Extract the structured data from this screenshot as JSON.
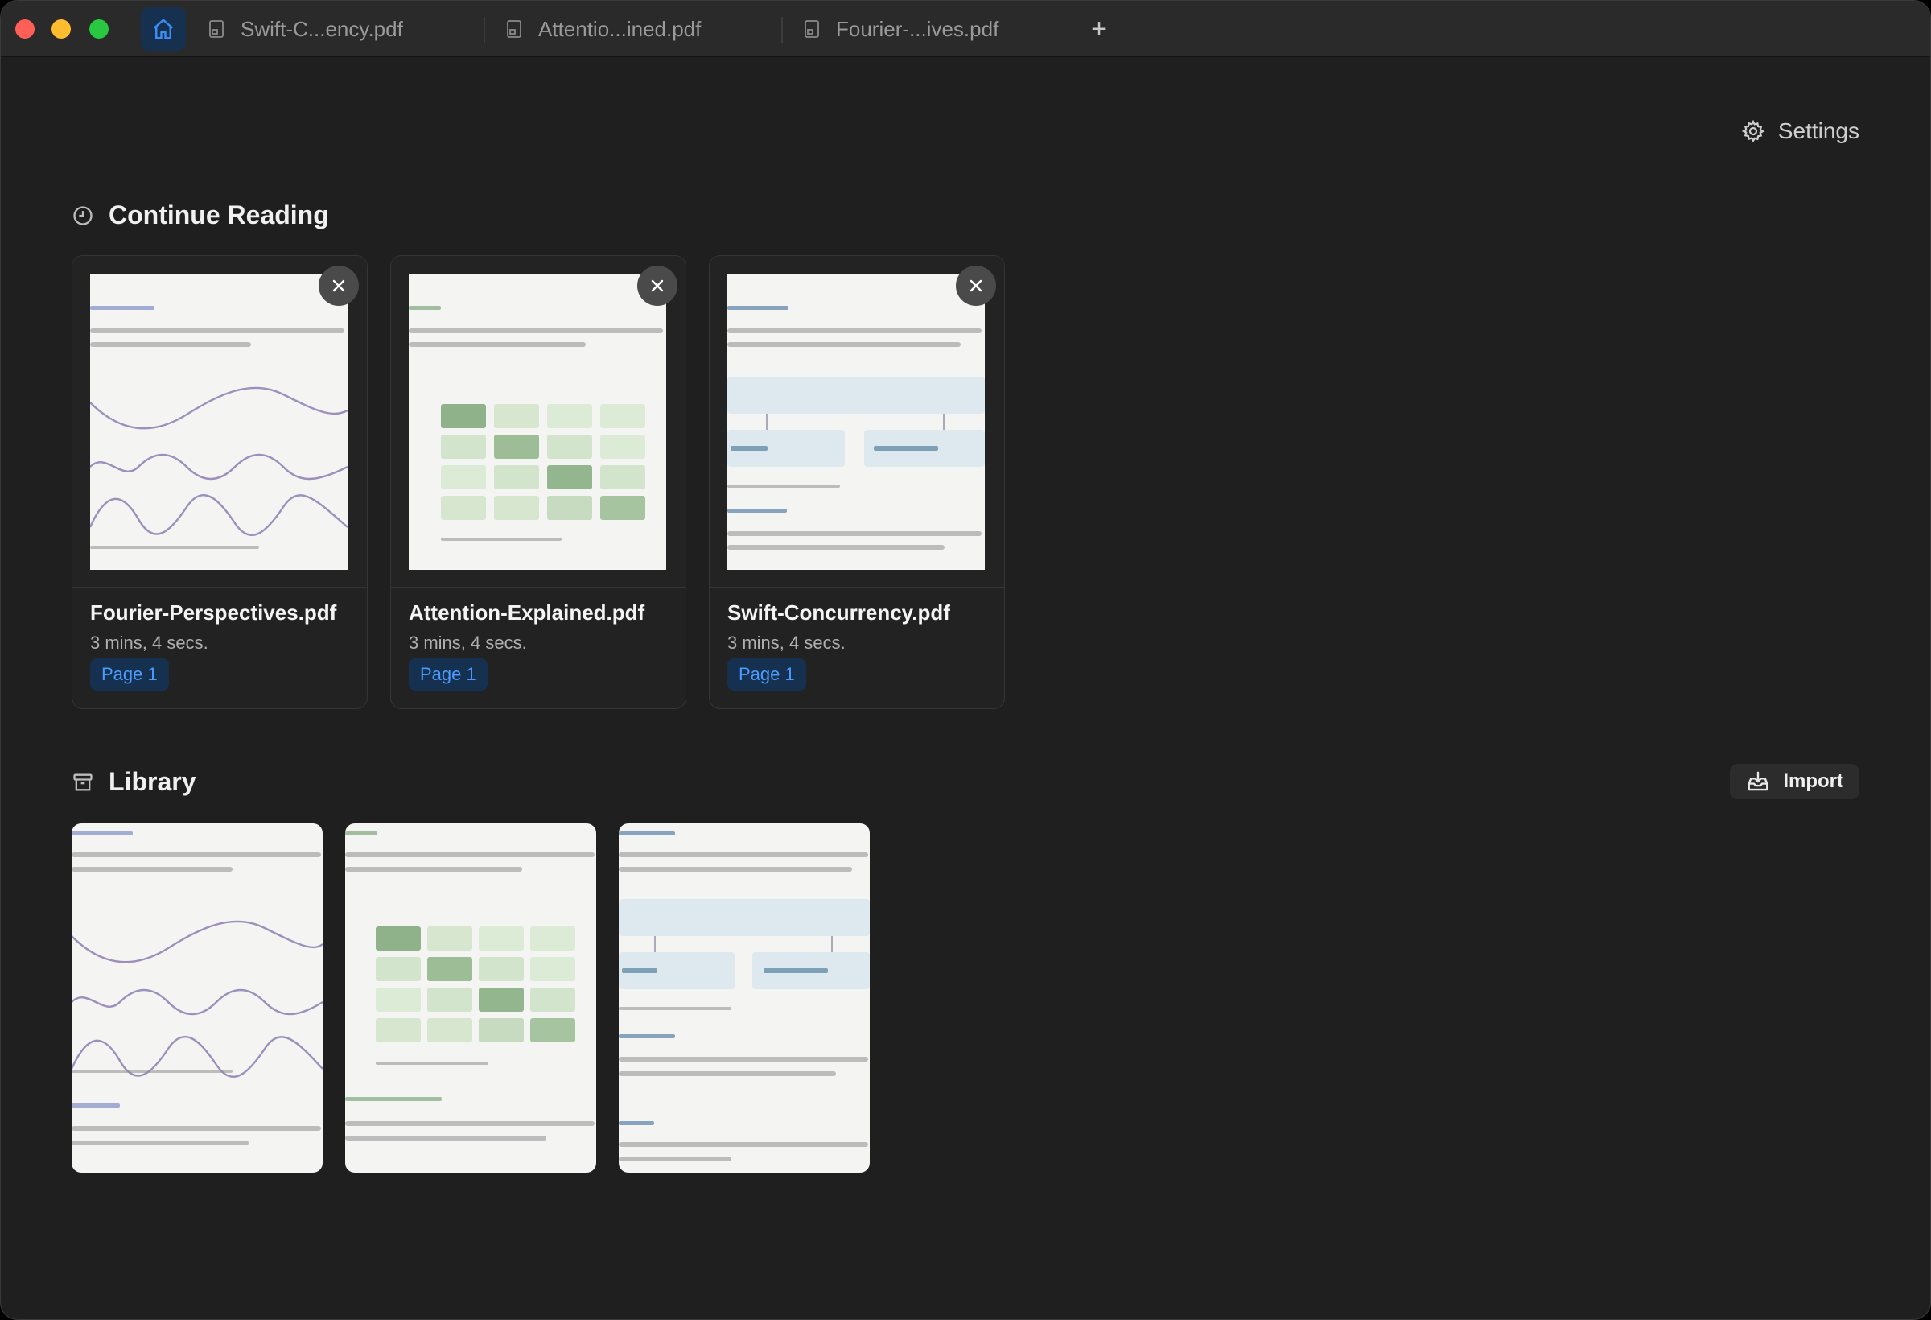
{
  "tabs": [
    {
      "label": "Swift-C...ency.pdf"
    },
    {
      "label": "Attentio...ined.pdf"
    },
    {
      "label": "Fourier-...ives.pdf"
    }
  ],
  "new_tab_label": "+",
  "settings_label": "Settings",
  "continue_reading": {
    "heading": "Continue Reading",
    "items": [
      {
        "title": "Fourier-Perspectives.pdf",
        "time": "3 mins, 4 secs.",
        "page": "Page 1"
      },
      {
        "title": "Attention-Explained.pdf",
        "time": "3 mins, 4 secs.",
        "page": "Page 1"
      },
      {
        "title": "Swift-Concurrency.pdf",
        "time": "3 mins, 4 secs.",
        "page": "Page 1"
      }
    ]
  },
  "library": {
    "heading": "Library",
    "import_label": "Import"
  },
  "colors": {
    "accent": "#4a9bff",
    "accent_bg": "#16304f",
    "background": "#1f1f1f"
  }
}
